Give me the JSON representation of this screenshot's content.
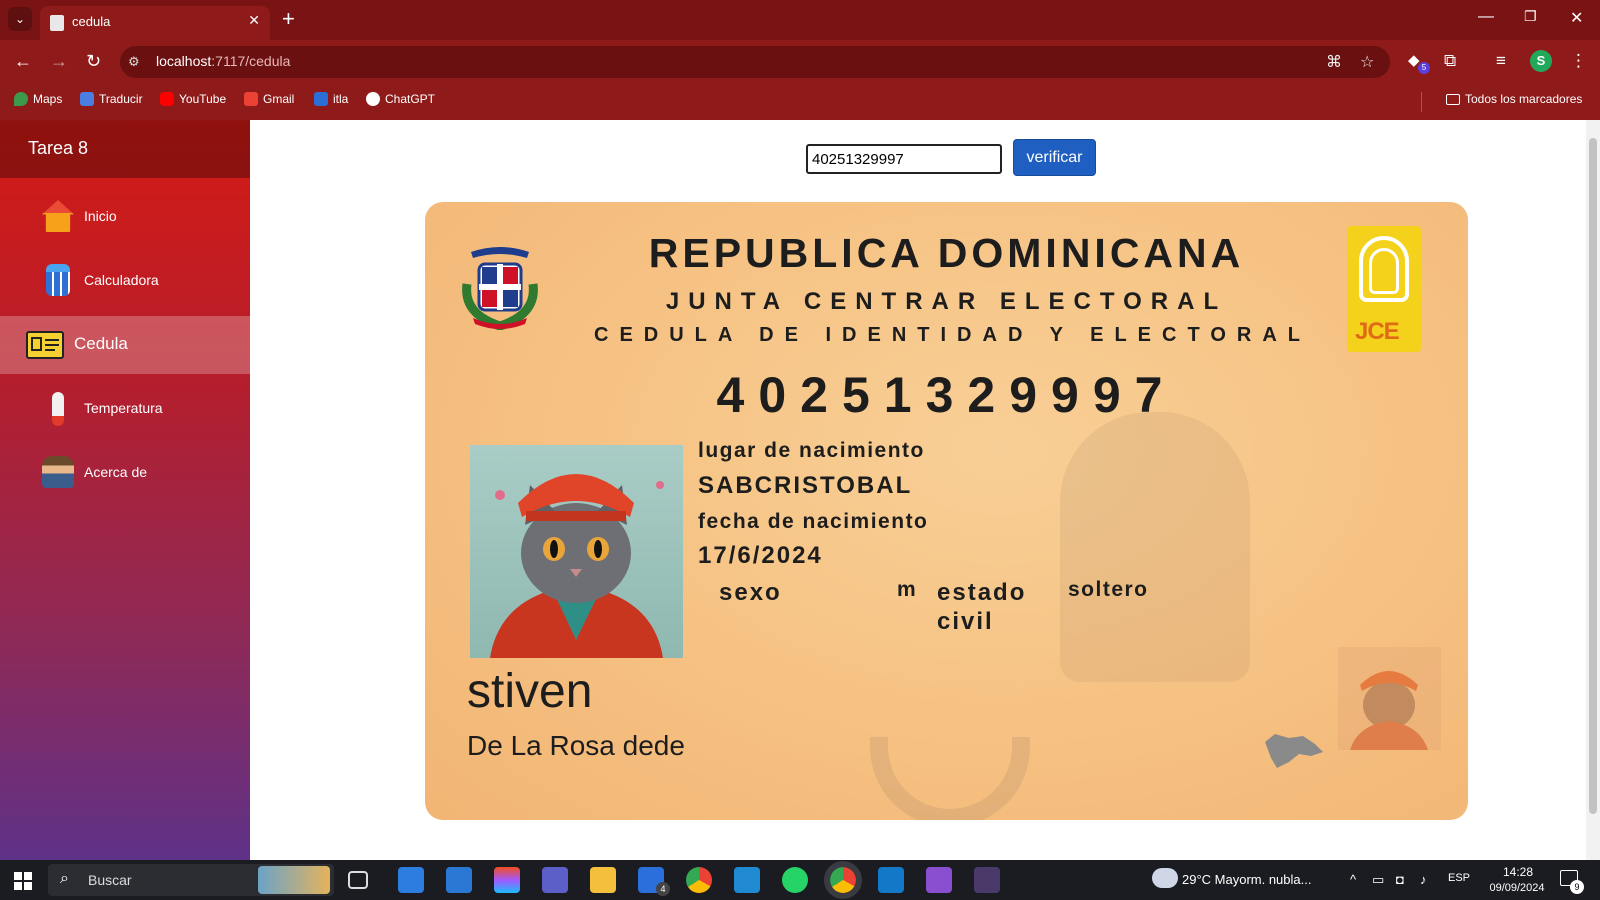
{
  "browser": {
    "tab_title": "cedula",
    "url_host": "localhost",
    "url_path": ":7117/cedula",
    "bookmarks": [
      "Maps",
      "Traducir",
      "YouTube",
      "Gmail",
      "itla",
      "ChatGPT"
    ],
    "all_bookmarks": "Todos los marcadores",
    "extension_badge": "5",
    "profile_initial": "S"
  },
  "sidebar": {
    "brand": "Tarea 8",
    "items": [
      {
        "label": "Inicio"
      },
      {
        "label": "Calculadora"
      },
      {
        "label": "Cedula"
      },
      {
        "label": "Temperatura"
      },
      {
        "label": "Acerca de"
      }
    ],
    "active_index": 2
  },
  "form": {
    "cedula_value": "40251329997",
    "verify_label": "verificar"
  },
  "card": {
    "country": "REPUBLICA DOMINICANA",
    "authority": "JUNTA CENTRAR ELECTORAL",
    "doc_type": "CEDULA DE IDENTIDAD Y ELECTORAL",
    "number": "40251329997",
    "jce": "JCE",
    "birthplace_label": "lugar de nacimiento",
    "birthplace": "SABCRISTOBAL",
    "birthdate_label": "fecha de nacimiento",
    "birthdate": "17/6/2024",
    "sex_label": "sexo",
    "sex": "m",
    "civil_label_1": "estado",
    "civil_label_2": "civil",
    "civil": "soltero",
    "first_name": "stiven",
    "last_name": "De La Rosa dede"
  },
  "taskbar": {
    "search": "Buscar",
    "weather": "29°C  Mayorm. nubla...",
    "lang": "ESP",
    "time": "14:28",
    "date": "09/09/2024",
    "notifications": "9",
    "todo_badge": "4"
  },
  "colors": {
    "browser_frame": "#8f1a1a",
    "sidebar_top": "#d41a14",
    "sidebar_bottom": "#5e3188",
    "card_bg": "#f6c182",
    "verify_button": "#1e5fc1"
  }
}
